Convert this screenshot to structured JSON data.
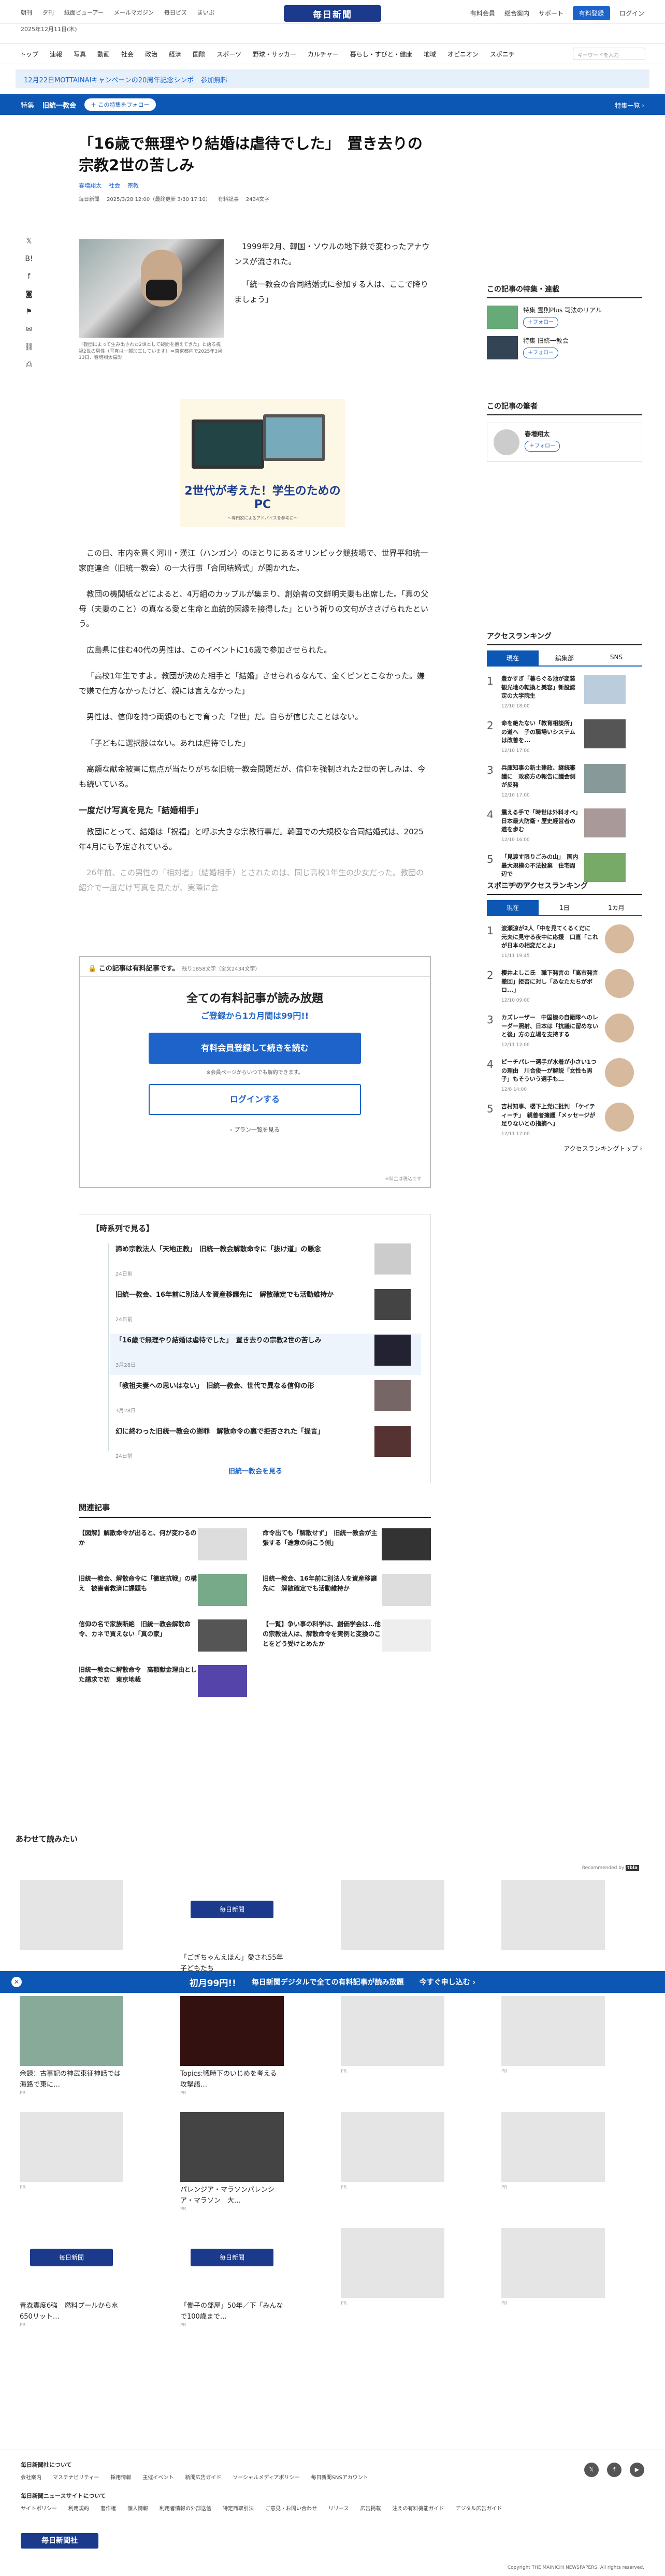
{
  "util": {
    "left": [
      "朝刊",
      "夕刊",
      "紙面ビューアー",
      "メールマガジン",
      "毎日ビズ",
      "まいぷ"
    ],
    "logo": "毎日新聞",
    "right": [
      "有料会員",
      "総合案内",
      "サポート"
    ],
    "register": "有料登録",
    "login": "ログイン"
  },
  "date": "2025年12月11日(木)",
  "nav": {
    "items": [
      "トップ",
      "速報",
      "写真",
      "動画",
      "社会",
      "政治",
      "経済",
      "国際",
      "スポーツ",
      "野球・サッカー",
      "カルチャー",
      "暮らし・すびと・健康",
      "地域",
      "オピニオン",
      "スポニチ"
    ],
    "search_placeholder": "キーワードを入力"
  },
  "banner": "12月22日MOTTAINAIキャンペーンの20周年記念シンポ　参加無料",
  "special": {
    "tag": "特集",
    "title": "旧統一教会",
    "follow": "＋ この特集をフォロー",
    "more": "特集一覧 ›"
  },
  "article": {
    "headline": "「16歳で無理やり結婚は虐待でした」　置き去りの宗教2世の苦しみ",
    "author": "春増翔太",
    "topics": [
      "社会",
      "宗教"
    ],
    "info": [
      "毎日新聞",
      "2025/3/28 12:00（最終更新 3/30 17:10）",
      "有料記事",
      "2434文字"
    ],
    "caption": "「教団によって生み出された2世として疑問を抱えてきた」と語る祝福2世の男性（写真は一部加工しています）＝東京都内で2025年3月13日、春増翔太撮影",
    "lede": [
      "1999年2月、韓国・ソウルの地下鉄で変わったアナウンスが流された。",
      "「統一教会の合同結婚式に参加する人は、ここで降りましょう」"
    ],
    "ad": {
      "title": "2世代が考えた！学生のためのPC",
      "sub": "〜専門家によるアドバイスを参考に〜"
    },
    "paras": [
      "この日、市内を貫く河川・漢江（ハンガン）のほとりにあるオリンピック競技場で、世界平和統一家庭連合（旧統一教会）の一大行事「合同結婚式」が開かれた。",
      "教団の機関紙などによると、4万組のカップルが集まり、創始者の文鮮明夫妻も出席した。「真の父母（夫妻のこと）の真なる愛と生命と血統的因縁を接得した」という祈りの文句がささげられたという。",
      "広島県に住む40代の男性は、このイベントに16歳で参加させられた。",
      "「高校1年生ですよ。教団が決めた相手と「結婚」させられるなんて、全くピンとこなかった。嫌で嫌で仕方なかったけど、親には言えなかった」",
      "男性は、信仰を持つ両親のもとで育った「2世」だ。自らが信じたことはない。",
      "「子どもに選択肢はない。あれは虐待でした」",
      "高額な献金被害に焦点が当たりがちな旧統一教会問題だが、信仰を強制された2世の苦しみは、今も続いている。"
    ],
    "subhead": "一度だけ写真を見た「結婚相手」",
    "paras2": [
      "教団にとって、結婚は「祝福」と呼ぶ大きな宗教行事だ。韓国での大規模な合同結婚式は、2025年4月にも予定されている。",
      "26年前、この男性の「相対者」（結婚相手）とされたのは、同じ高校1年生の少女だった。教団の紹介で一度だけ写真を見たが、実際に会"
    ]
  },
  "paywall": {
    "label": "この記事は有料記事です。",
    "remain": "残り1858文字（全文2434文字）",
    "title": "全ての有料記事が読み放題",
    "sub": "ご登録から1カ月間は99円!!",
    "register": "有料会員登録して続きを読む",
    "note": "※会員ページからいつでも解約できます。",
    "login": "ログインする",
    "plan": "プラン一覧を見る",
    "foot": "※料金は税込です"
  },
  "timeline": {
    "title": "【時系列で見る】",
    "more": "旧統一教会を見る",
    "items": [
      {
        "t": "諦め宗教法人「天地正教」　旧統一教会解散命令に「抜け道」の懸念",
        "d": "24日前"
      },
      {
        "t": "旧統一教会、16年前に別法人を資産移譲先に　解散確定でも活動維持か",
        "d": "24日前"
      },
      {
        "t": "「16歳で無理やり結婚は虐待でした」　置き去りの宗教2世の苦しみ",
        "d": "3月28日"
      },
      {
        "t": "「教祖夫妻への思いはない」　旧統一教会、世代で異なる信仰の形",
        "d": "3月28日"
      },
      {
        "t": "幻に終わった旧統一教会の謝罪　解散命令の裏で拒否された「提言」",
        "d": "24日前"
      }
    ]
  },
  "related": {
    "title": "関連記事",
    "items": [
      "【図解】解散命令が出ると、何が変わるのか",
      "命令出ても「解散せず」　旧統一教会が主張する「途意の向こう側」",
      "旧統一教会、解散命令に「徹底抗戦」の構え　被害者救済に課題も",
      "旧統一教会、16年前に別法人を資産移譲先に　解散確定でも活動維持か",
      "信仰の名で家族断絶　旧統一教会解散命令、カネで買えない「真の家」",
      "【一覧】争い事の科学は、創価学会は…他の宗教法人は、解散命令を実例と変換のことをどう受けとめたか",
      "旧統一教会に解散命令　高額献金理由とした請求で初　東京地裁"
    ]
  },
  "rec": {
    "title": "あわせて読みたい",
    "by": "Recommended by",
    "cards": [
      {
        "t": "",
        "pr": ""
      },
      {
        "t": "「ごぎちゃんえほん」愛され55年　子どもたち",
        "pr": ""
      },
      {
        "t": "",
        "pr": ""
      },
      {
        "t": "",
        "pr": ""
      },
      {
        "t": "余録：古事記の神武東征神話では海路で東に…",
        "pr": "PR"
      },
      {
        "t": "Topics:戦時下のいじめを考える　攻撃語…",
        "pr": "PR"
      },
      {
        "t": "",
        "pr": "PR"
      },
      {
        "t": "",
        "pr": "PR"
      },
      {
        "t": "",
        "pr": "PR"
      },
      {
        "t": "パレンジア・マラソンパレンシア・マラソン　大…",
        "pr": "PR"
      },
      {
        "t": "",
        "pr": "PR"
      },
      {
        "t": "",
        "pr": "PR"
      },
      {
        "t": "青森震度6強　燃料プールから水650リット…",
        "pr": "PR"
      },
      {
        "t": "「働子の部屋」50年／下「みんなで100歳まで…",
        "pr": "PR"
      },
      {
        "t": "",
        "pr": "PR"
      },
      {
        "t": "",
        "pr": "PR"
      }
    ]
  },
  "sticky": {
    "a": "初月99円!!",
    "b": "毎日新聞デジタルで全ての有料記事が読み放題",
    "c": "今すぐ申し込む ›"
  },
  "side": {
    "series_title": "この記事の特集・連載",
    "series": [
      {
        "t": "特集 霊則Plus 司法のリアル"
      },
      {
        "t": "特集 旧統一教会"
      }
    ],
    "author_title": "この記事の筆者",
    "author": "春増翔太",
    "rank_title": "アクセスランキング",
    "rank_tabs": [
      "現在",
      "編集部",
      "SNS"
    ],
    "rank": [
      {
        "t": "豊かすぎ「暮らぐる池が変装　観光地の転換と美容」新設認定の大学院生",
        "d": "12/10 18:00"
      },
      {
        "t": "命を絶たない「教育相談所」の道へ　子の職場いシステムは改善を...",
        "d": "12/10 17:00"
      },
      {
        "t": "兵庫知事の新土建政、継続審議に　政務方の報告に議会側が反発",
        "d": "12/10 17:00"
      },
      {
        "t": "震える手で「時世は外科オペ」　日本最大防衛・歴史経営者の道を歩む",
        "d": "12/10 16:00"
      },
      {
        "t": "「見渡す限りごみの山」　国内最大規模の不法投棄　住宅周辺で",
        "d": "12/9 00:00"
      }
    ],
    "spo_title": "スポニチのアクセスランキング",
    "spo_tabs": [
      "現在",
      "1日",
      "1カ月"
    ],
    "spo": [
      {
        "t": "波瀬涼が2人「中を見てくるくだに　元夫に見守る夜中に応援　口直「これが日本の相変だとよ」",
        "d": "11/11 19:45"
      },
      {
        "t": "櫻井よしこ氏　職下発言の「高市発言撤回」拒否に対し「あなたたちがボロ...」",
        "d": "12/10 09:00"
      },
      {
        "t": "カズレーザー　中国機の自衛隊へのレーダー照射、日本は「抗議に留めないと後」方の立場を支持する",
        "d": "12/11 12:00"
      },
      {
        "t": "ピーチパレー選手が水着が小さい1つの理由　川合俊一が解説「女性も男子」もそういう選手も…",
        "d": "12/8 14:00"
      },
      {
        "t": "吉村知事、櫻下上党に批判　「ケイティーチ」　親善者擁護「メッセージが足りないとの指摘へ」",
        "d": "12/11 17:00"
      }
    ],
    "rank_more": "アクセスランキングトップ ›"
  },
  "footer": {
    "r1": "毎日新聞社について",
    "l1": [
      "会社案内",
      "マステナビリティー",
      "採用情報",
      "主催イベント",
      "新聞広告ガイド",
      "ソーシャルメディアポリシー",
      "毎日新聞SNSアカウント"
    ],
    "r2": "毎日新聞ニュースサイトについて",
    "l2": [
      "サイトポリシー",
      "利用規約",
      "著作権",
      "個人情報",
      "利用者情報の外部送信",
      "特定商取引法",
      "ご意見・お問い合わせ",
      "リリース",
      "広告掲載",
      "注えの有料機能ガイド",
      "デジタル広告ガイド"
    ],
    "logo": "毎日新聞社",
    "copy": "Copyright THE MAINICHI NEWSPAPERS. All rights reserved."
  }
}
